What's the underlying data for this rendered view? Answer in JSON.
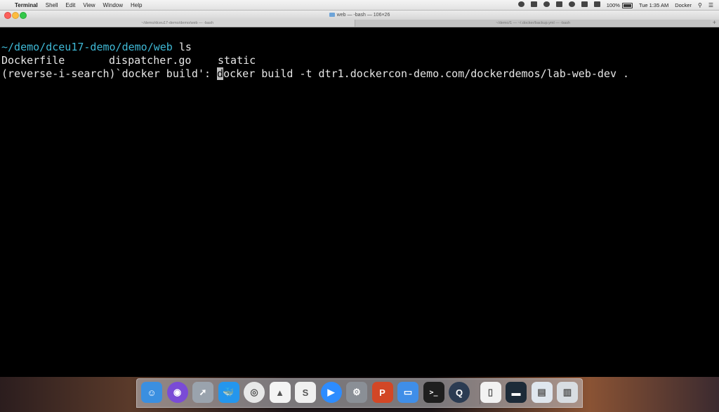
{
  "menubar": {
    "apple_glyph": "",
    "app_name": "Terminal",
    "menus": [
      "Shell",
      "Edit",
      "View",
      "Window",
      "Help"
    ],
    "battery_percent": "100%",
    "clock": "Tue 1:35 AM",
    "user": "Docker"
  },
  "window": {
    "title": "web — -bash — 106×26"
  },
  "tabs": [
    {
      "label": "~/demo/dceu17-demo/demo/web — -bash"
    },
    {
      "label": "~/demo/1 — ~/.docker/backup.yml — -bash"
    }
  ],
  "tab_add_glyph": "+",
  "terminal": {
    "line1_path": "~/demo/dceu17-demo/demo/web",
    "line1_cmd": " ls",
    "ls_items": [
      "Dockerfile",
      "dispatcher.go",
      "static"
    ],
    "search_prefix": "(reverse-i-search)`docker build': ",
    "cursor_char": "d",
    "search_rest": "ocker build -t dtr1.dockercon-demo.com/dockerdemos/lab-web-dev ."
  },
  "dock": {
    "icons": [
      {
        "name": "finder-icon",
        "color": "#3b8fe0"
      },
      {
        "name": "siri-icon",
        "color": "#7a4bd6"
      },
      {
        "name": "launchpad-icon",
        "color": "#9aa3ad"
      },
      {
        "name": "docker-icon",
        "color": "#2496ed"
      },
      {
        "name": "chrome-icon",
        "color": "#e8e8e8"
      },
      {
        "name": "google-drive-icon",
        "color": "#f4f4f4"
      },
      {
        "name": "slides-icon",
        "color": "#f0f0f0"
      },
      {
        "name": "zoom-icon",
        "color": "#2d8cff"
      },
      {
        "name": "system-preferences-icon",
        "color": "#8a8f96"
      },
      {
        "name": "powerpoint-icon",
        "color": "#d24726"
      },
      {
        "name": "keynote-icon",
        "color": "#3f8ee8"
      },
      {
        "name": "terminal-icon",
        "color": "#1e1e1e"
      },
      {
        "name": "quicktime-icon",
        "color": "#2b3b52"
      },
      {
        "name": "document-icon",
        "color": "#f2f2f2"
      },
      {
        "name": "screenshot-thumb-icon",
        "color": "#1c2a38"
      },
      {
        "name": "browser-window-icon",
        "color": "#dfe6ee"
      },
      {
        "name": "trash-icon",
        "color": "#d8dde2"
      }
    ]
  }
}
